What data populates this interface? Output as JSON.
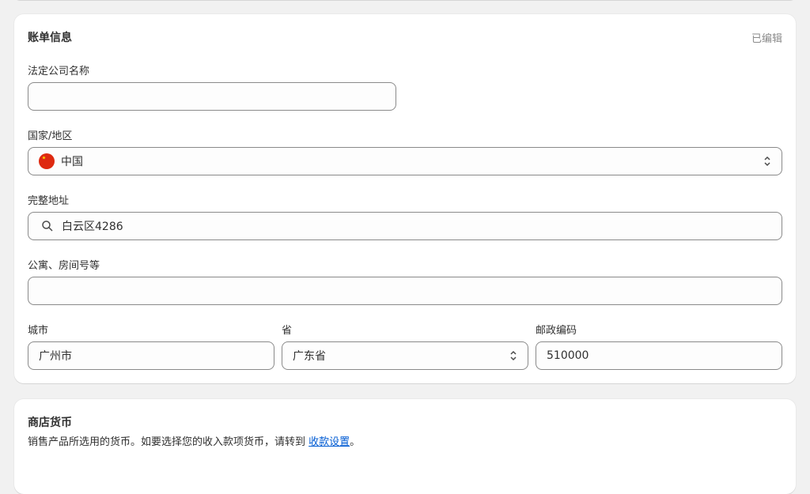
{
  "billing": {
    "title": "账单信息",
    "status": "已编辑",
    "company_label": "法定公司名称",
    "company_value": "",
    "country_label": "国家/地区",
    "country_value": "中国",
    "address_label": "完整地址",
    "address_value": "白云区4286",
    "apartment_label": "公寓、房间号等",
    "apartment_value": "",
    "city_label": "城市",
    "city_value": "广州市",
    "province_label": "省",
    "province_value": "广东省",
    "postal_label": "邮政编码",
    "postal_value": "510000"
  },
  "currency": {
    "title": "商店货币",
    "desc_prefix": "销售产品所选用的货币。如要选择您的收入款项货币，请转到 ",
    "link_label": "收款设置",
    "desc_suffix": "。"
  },
  "icons": {
    "country_flag": "china-flag-icon",
    "select_chevron": "select-chevron-icon",
    "search": "search-icon"
  },
  "colors": {
    "link": "#005bd3",
    "muted": "#8a8a8a",
    "flag_red": "#de2910",
    "flag_star": "#ffde00"
  }
}
